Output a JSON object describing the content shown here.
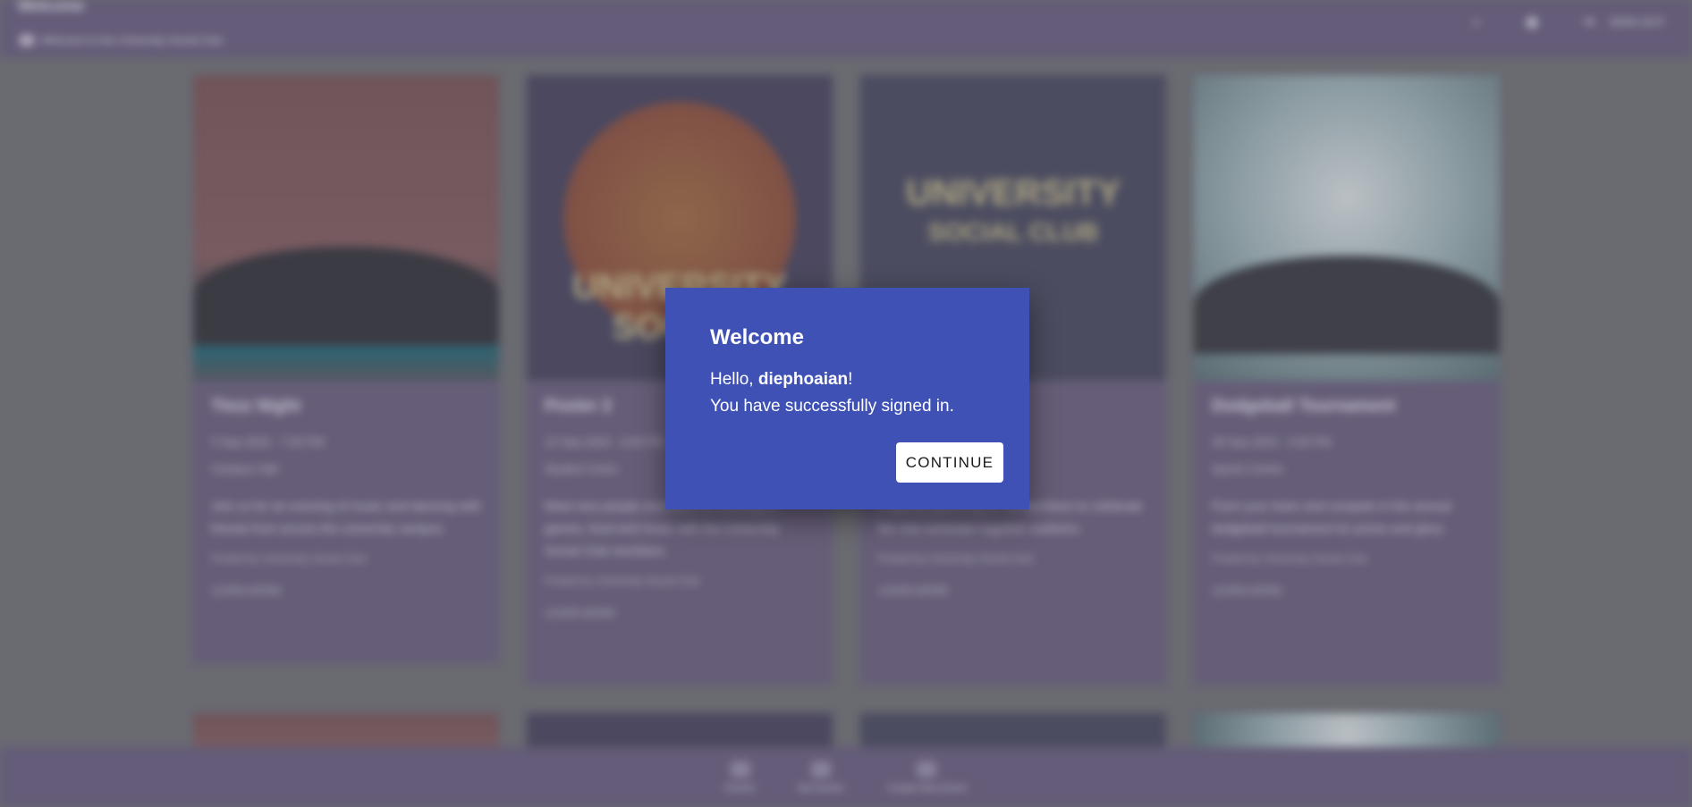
{
  "app": {
    "title": "Welcome",
    "breadcrumb": "Welcome to the University Social Club"
  },
  "topbar": {
    "signout_label": "SIGN OUT"
  },
  "cards": [
    {
      "title": "Tiezz Night",
      "meta1": "5 Sep 2023 · 7:00 PM",
      "meta2": "Campus Hall",
      "desc": "Join us for an evening of music and dancing with friends from across the university campus.",
      "foot": "Posted by University Social Club",
      "link": "LEARN MORE"
    },
    {
      "title": "Poster 2",
      "meta1": "12 Sep 2023 · 6:00 PM",
      "meta2": "Student Union",
      "desc": "Meet new people and enjoy an evening of games, food and music with the University Social Club members.",
      "foot": "Posted by University Social Club",
      "link": "LEARN MORE"
    },
    {
      "title": "Social Club",
      "meta1": "20 Sep 2023 · 8:00 PM",
      "meta2": "Main Lawn",
      "desc": "A special gathering for all members to celebrate the new semester together outdoors.",
      "foot": "Posted by University Social Club",
      "link": "LEARN MORE"
    },
    {
      "title": "Dodgeball Tournament",
      "meta1": "28 Sep 2023 · 5:00 PM",
      "meta2": "Sports Centre",
      "desc": "Form your team and compete in the annual dodgeball tournament for prizes and glory.",
      "foot": "Posted by University Social Club",
      "link": "LEARN MORE"
    }
  ],
  "poster_text": {
    "p2": "UNIVERSITY SOCIAL",
    "p3_line1": "UNIVERSITY",
    "p3_line2": "SOCIAL CLUB"
  },
  "bottom_nav": [
    {
      "label": "Events",
      "icon": "calendar-icon"
    },
    {
      "label": "My Events",
      "icon": "bookmark-icon"
    },
    {
      "label": "Create New Event",
      "icon": "add-icon"
    }
  ],
  "dialog": {
    "title": "Welcome",
    "greeting_prefix": "Hello, ",
    "username": "diephoaian",
    "greeting_suffix": "!",
    "message": "You have successfully signed in.",
    "continue_label": "CONTINUE",
    "bg_color": "#3f51b5"
  }
}
